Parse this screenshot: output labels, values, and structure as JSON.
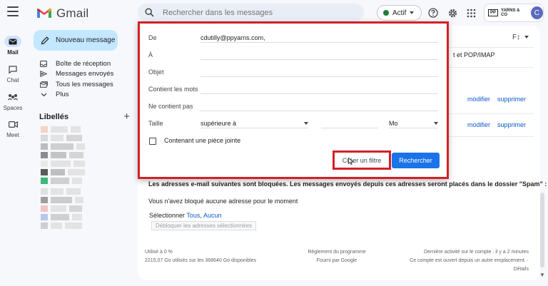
{
  "app": {
    "name": "Gmail"
  },
  "rail": {
    "items": [
      {
        "label": "Mail"
      },
      {
        "label": "Chat"
      },
      {
        "label": "Spaces"
      },
      {
        "label": "Meet"
      }
    ]
  },
  "search": {
    "placeholder": "Rechercher dans les messages"
  },
  "status": {
    "label": "Actif",
    "color": "#188038"
  },
  "account": {
    "brand_box": "PP",
    "brand_text": "YARNS & CO",
    "avatar_initial": "C"
  },
  "sidebar": {
    "compose_label": "Nouveau message",
    "items": [
      {
        "label": "Boîte de réception"
      },
      {
        "label": "Messages envoyés"
      },
      {
        "label": "Tous les messages"
      },
      {
        "label": "Plus"
      }
    ],
    "labels_heading": "Libellés"
  },
  "filter": {
    "from_label": "De",
    "from_value": "cdutilly@ppyarns.com,",
    "to_label": "À",
    "subject_label": "Objet",
    "has_words_label": "Contient les mots",
    "no_words_label": "Ne contient pas",
    "size_label": "Taille",
    "size_operator": "supérieure à",
    "size_unit": "Mo",
    "attachment_label": "Contenant une pièce jointe",
    "create_filter": "Créer un filtre",
    "search_button": "Rechercher"
  },
  "settings": {
    "font_icon": "F↕",
    "pop_imap": "t et POP/IMAP",
    "modify": "modifier",
    "delete": "supprimer"
  },
  "blocked": {
    "title": "Les adresses e-mail suivantes sont bloquées. Les messages envoyés depuis ces adresses seront placés dans le dossier \"Spam\" :",
    "none": "Vous n'avez bloqué aucune adresse pour le moment",
    "select_prefix": "Sélectionner",
    "select_all": "Tous",
    "select_none": "Aucun",
    "unblock_button": "Débloquer les adresses sélectionnées"
  },
  "footer": {
    "usage": "Utilisé à 0 %",
    "storage": "2215,07 Go utilisés sur les 368640 Go disponibles",
    "program": "Règlement du programme",
    "provided": "Fourni par Google",
    "last_activity": "Dernière activité sur le compte : il y a 2 minutes",
    "open_elsewhere": "Ce compte est ouvert depuis un autre emplacement. ·",
    "details": "Détails"
  },
  "colors": {
    "accent": "#1a73e8",
    "highlight": "#d32027",
    "compose": "#c2e7ff"
  }
}
